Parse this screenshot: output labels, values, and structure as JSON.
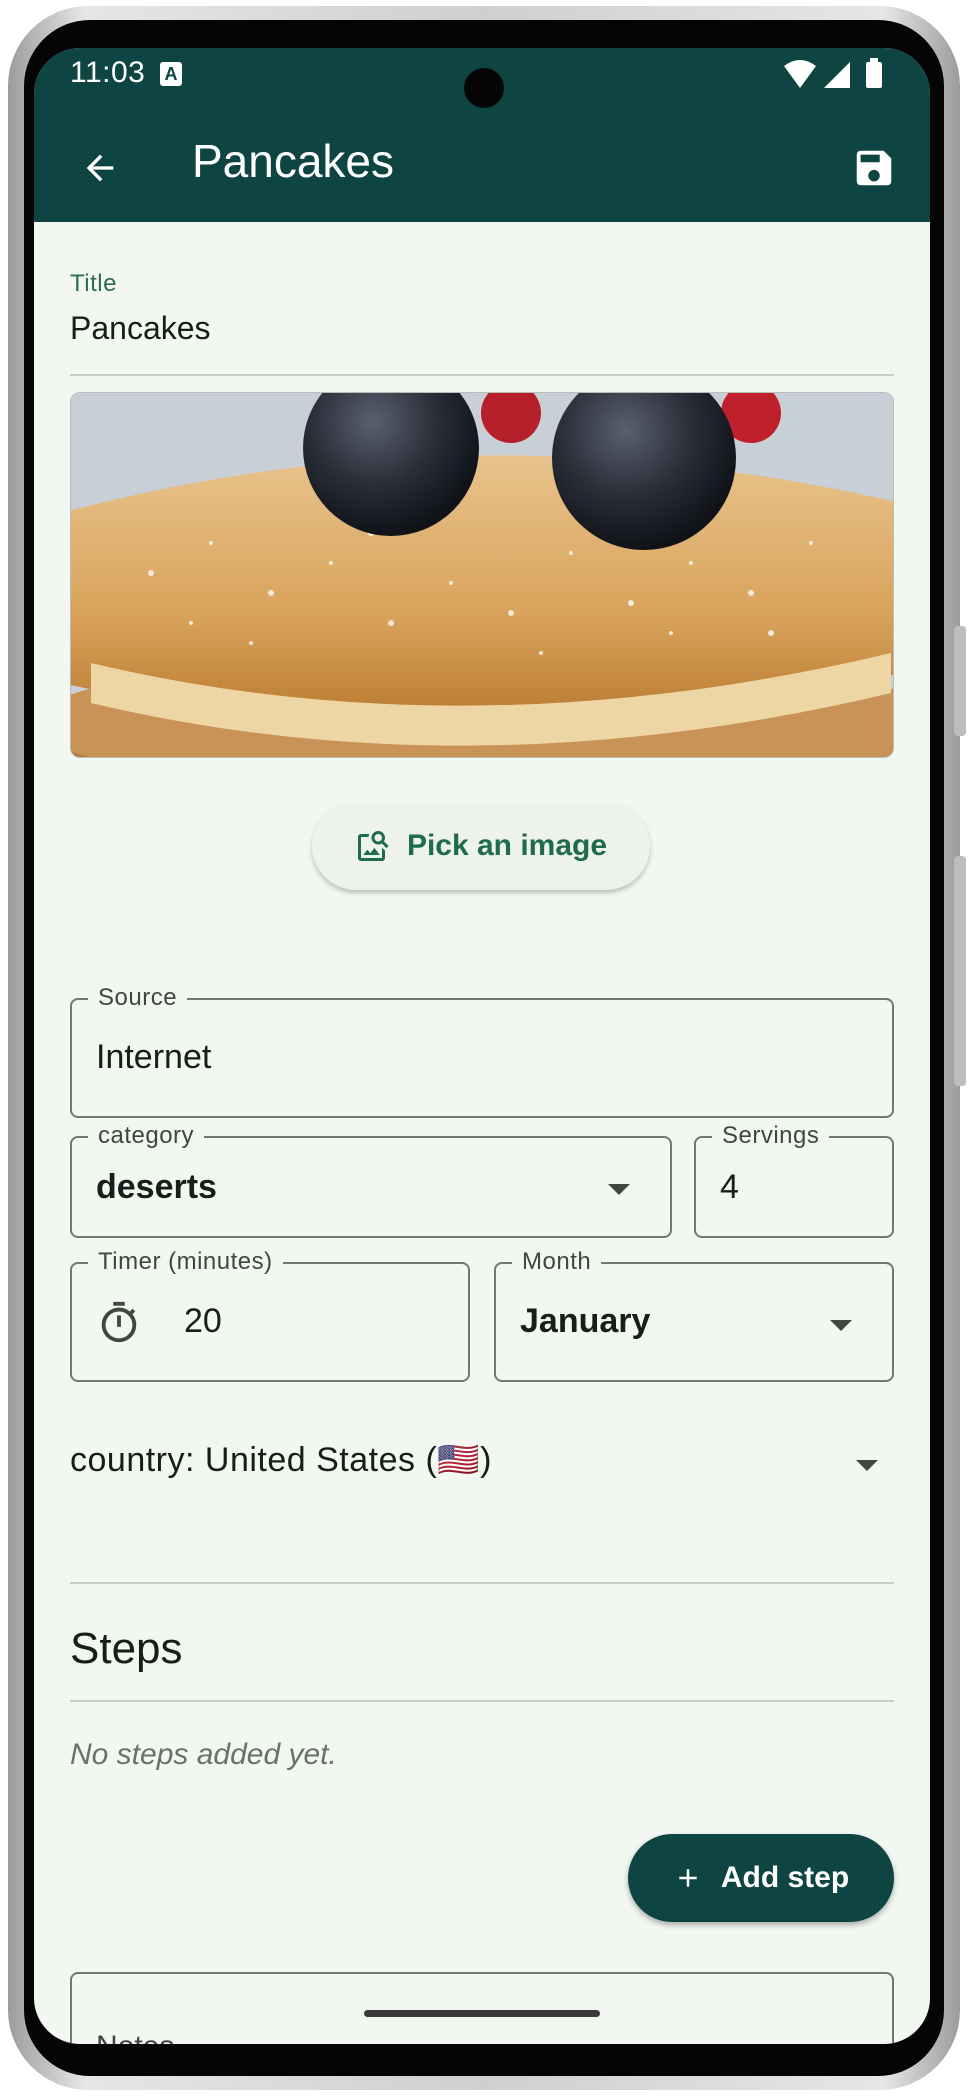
{
  "status_bar": {
    "time": "11:03",
    "indicator": "A",
    "icons": [
      "wifi-icon",
      "signal-icon",
      "battery-icon"
    ]
  },
  "app_bar": {
    "title": "Pancakes",
    "back_icon": "arrow-back-icon",
    "save_icon": "save-icon"
  },
  "form": {
    "title": {
      "label": "Title",
      "value": "Pancakes"
    },
    "image": {
      "alt": "pancake-with-berries-photo"
    },
    "pick_image_button": {
      "label": "Pick an image",
      "icon": "image-search-icon"
    },
    "source": {
      "label": "Source",
      "value": "Internet"
    },
    "category": {
      "label": "category",
      "value": "deserts"
    },
    "servings": {
      "label": "Servings",
      "value": "4"
    },
    "timer": {
      "label": "Timer (minutes)",
      "value": "20",
      "icon": "timer-icon"
    },
    "month": {
      "label": "Month",
      "value": "January"
    },
    "country": {
      "text": "country: United States (🇺🇸)"
    }
  },
  "steps": {
    "heading": "Steps",
    "empty_text": "No steps added yet.",
    "add_button": {
      "label": "Add step",
      "icon": "plus-icon"
    }
  },
  "notes": {
    "label": "Notes"
  },
  "colors": {
    "primary": "#0e4543",
    "background": "#f2f7f1",
    "accent_text": "#1f6b4d"
  }
}
